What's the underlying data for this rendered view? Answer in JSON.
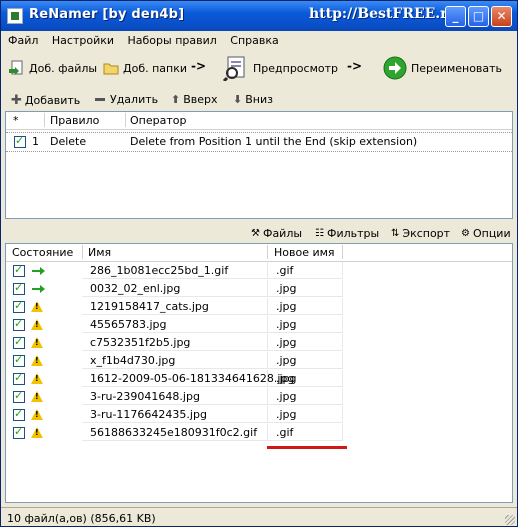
{
  "window": {
    "title": "ReNamer  [by den4b]",
    "watermark": "http://BestFREE.ru"
  },
  "menu": [
    "Файл",
    "Настройки",
    "Наборы правил",
    "Справка"
  ],
  "toolbar": {
    "add_files": "Доб. файлы",
    "add_folders": "Доб. папки",
    "arrow1": "->",
    "preview": "Предпросмотр",
    "arrow2": "->",
    "rename": "Переименовать"
  },
  "rules_toolbar": {
    "add": "Добавить",
    "delete": "Удалить",
    "up": "Вверх",
    "down": "Вниз"
  },
  "rules_table": {
    "headers": [
      "*",
      "Правило",
      "Оператор"
    ],
    "rows": [
      {
        "checked": true,
        "index": "1",
        "rule": "Delete",
        "operator": "Delete from Position 1 until the End (skip extension)"
      }
    ]
  },
  "files_tabs": {
    "files": "Файлы",
    "filters": "Фильтры",
    "export": "Экспорт",
    "options": "Опции"
  },
  "files_table": {
    "headers": [
      "Состояние",
      "Имя",
      "Новое имя"
    ],
    "rows": [
      {
        "state": "arrow",
        "name": "286_1b081ecc25bd_1.gif",
        "new": ".gif"
      },
      {
        "state": "arrow",
        "name": "0032_02_enl.jpg",
        "new": ".jpg"
      },
      {
        "state": "warning",
        "name": "1219158417_cats.jpg",
        "new": ".jpg"
      },
      {
        "state": "warning",
        "name": "45565783.jpg",
        "new": ".jpg"
      },
      {
        "state": "warning",
        "name": "c7532351f2b5.jpg",
        "new": ".jpg"
      },
      {
        "state": "warning",
        "name": "x_f1b4d730.jpg",
        "new": ".jpg"
      },
      {
        "state": "warning",
        "name": "1612-2009-05-06-181334641628.jpg",
        "new": ".jpg"
      },
      {
        "state": "warning",
        "name": "3-ru-239041648.jpg",
        "new": ".jpg"
      },
      {
        "state": "warning",
        "name": "3-ru-1176642435.jpg",
        "new": ".jpg"
      },
      {
        "state": "warning",
        "name": "56188633245e180931f0c2.gif",
        "new": ".gif"
      }
    ]
  },
  "status": "10 файл(а,ов) (856,61 KB)",
  "colors": {
    "accent_green": "#21A121",
    "warning": "#F2C200",
    "highlight_red": "#D01818"
  }
}
